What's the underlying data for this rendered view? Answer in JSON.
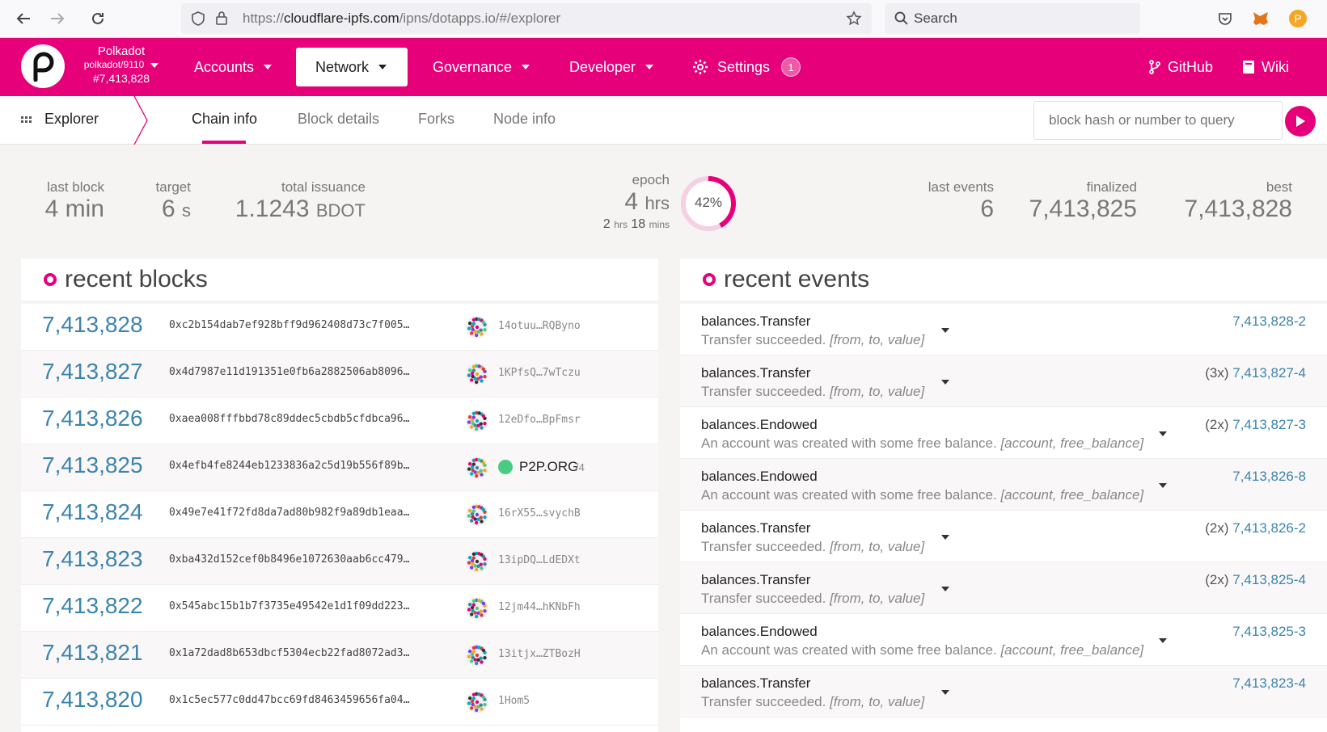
{
  "browser": {
    "url_prefix": "https://",
    "url_domain": "cloudflare-ipfs.com",
    "url_path": "/ipns/dotapps.io/#/explorer",
    "search_placeholder": "Search"
  },
  "header": {
    "chain_name": "Polkadot",
    "chain_spec": "polkadot/9110",
    "chain_block": "#7,413,828",
    "menu": {
      "accounts": "Accounts",
      "network": "Network",
      "governance": "Governance",
      "developer": "Developer",
      "settings": "Settings",
      "settings_badge": "1",
      "github": "GitHub",
      "wiki": "Wiki"
    }
  },
  "subnav": {
    "section": "Explorer",
    "tabs": [
      "Chain info",
      "Block details",
      "Forks",
      "Node info"
    ],
    "query_placeholder": "block hash or number to query"
  },
  "summary": {
    "last_block_label": "last block",
    "last_block_value": "4",
    "last_block_unit": "min",
    "target_label": "target",
    "target_value": "6",
    "target_unit": "s",
    "issuance_label": "total issuance",
    "issuance_value": "1.1243",
    "issuance_unit": "BDOT",
    "epoch_label": "epoch",
    "epoch_value": "4",
    "epoch_unit": "hrs",
    "epoch_remaining_hrs": "2",
    "epoch_remaining_hrs_unit": "hrs",
    "epoch_remaining_mins": "18",
    "epoch_remaining_mins_unit": "mins",
    "epoch_progress_text": "42%",
    "epoch_progress": 0.42,
    "last_events_label": "last events",
    "last_events_value": "6",
    "finalized_label": "finalized",
    "finalized_value": "7,413,825",
    "best_label": "best",
    "best_value": "7,413,828"
  },
  "recent_blocks": {
    "title": "recent blocks",
    "rows": [
      {
        "number": "7,413,828",
        "hash": "0xc2b154dab7ef928bff9d962408d73c7f005…",
        "author": "14otuu…RQByno"
      },
      {
        "number": "7,413,827",
        "hash": "0x4d7987e11d191351e0fb6a2882506ab8096…",
        "author": "1KPfsQ…7wTczu"
      },
      {
        "number": "7,413,826",
        "hash": "0xaea008fffbbd78c89ddec5cbdb5cfdbca96…",
        "author": "12eDfo…BpFmsr"
      },
      {
        "number": "7,413,825",
        "hash": "0x4efb4fe8244eb1233836a2c5d19b556f89b…",
        "author": "P2P.ORG",
        "author_suffix": "/4",
        "named": true
      },
      {
        "number": "7,413,824",
        "hash": "0x49e7e41f72fd8da7ad80b982f9a89db1eaa…",
        "author": "16rX55…svychB"
      },
      {
        "number": "7,413,823",
        "hash": "0xba432d152cef0b8496e1072630aab6cc479…",
        "author": "13ipDQ…LdEDXt"
      },
      {
        "number": "7,413,822",
        "hash": "0x545abc15b1b7f3735e49542e1d1f09dd223…",
        "author": "12jm44…hKNbFh"
      },
      {
        "number": "7,413,821",
        "hash": "0x1a72dad8b653dbcf5304ecb22fad8072ad3…",
        "author": "13itjx…ZTBozH"
      },
      {
        "number": "7,413,820",
        "hash": "0x1c5ec577c0dd47bcc69fd8463459656fa04…",
        "author": "1Hom5"
      }
    ]
  },
  "recent_events": {
    "title": "recent events",
    "rows": [
      {
        "name": "balances.Transfer",
        "desc": "Transfer succeeded.",
        "args": "[from, to, value]",
        "count": "",
        "ref": "7,413,828-2"
      },
      {
        "name": "balances.Transfer",
        "desc": "Transfer succeeded.",
        "args": "[from, to, value]",
        "count": "(3x)",
        "ref": "7,413,827-4"
      },
      {
        "name": "balances.Endowed",
        "desc": "An account was created with some free balance.",
        "args": "[account, free_balance]",
        "count": "(2x)",
        "ref": "7,413,827-3"
      },
      {
        "name": "balances.Endowed",
        "desc": "An account was created with some free balance.",
        "args": "[account, free_balance]",
        "count": "",
        "ref": "7,413,826-8"
      },
      {
        "name": "balances.Transfer",
        "desc": "Transfer succeeded.",
        "args": "[from, to, value]",
        "count": "(2x)",
        "ref": "7,413,826-2"
      },
      {
        "name": "balances.Transfer",
        "desc": "Transfer succeeded.",
        "args": "[from, to, value]",
        "count": "(2x)",
        "ref": "7,413,825-4"
      },
      {
        "name": "balances.Endowed",
        "desc": "An account was created with some free balance.",
        "args": "[account, free_balance]",
        "count": "",
        "ref": "7,413,825-3"
      },
      {
        "name": "balances.Transfer",
        "desc": "Transfer succeeded.",
        "args": "[from, to, value]",
        "count": "",
        "ref": "7,413,823-4"
      }
    ]
  },
  "colors": {
    "brand": "#e6007a",
    "link": "#3b84ad"
  },
  "icons": [
    "back-arrow-icon",
    "forward-arrow-icon",
    "reload-icon",
    "shield-icon",
    "lock-icon",
    "star-icon",
    "search-icon",
    "pocket-icon",
    "metamask-icon",
    "extension-icon",
    "polkadot-logo",
    "gear-icon",
    "github-icon",
    "book-icon",
    "grid-icon",
    "play-icon"
  ]
}
